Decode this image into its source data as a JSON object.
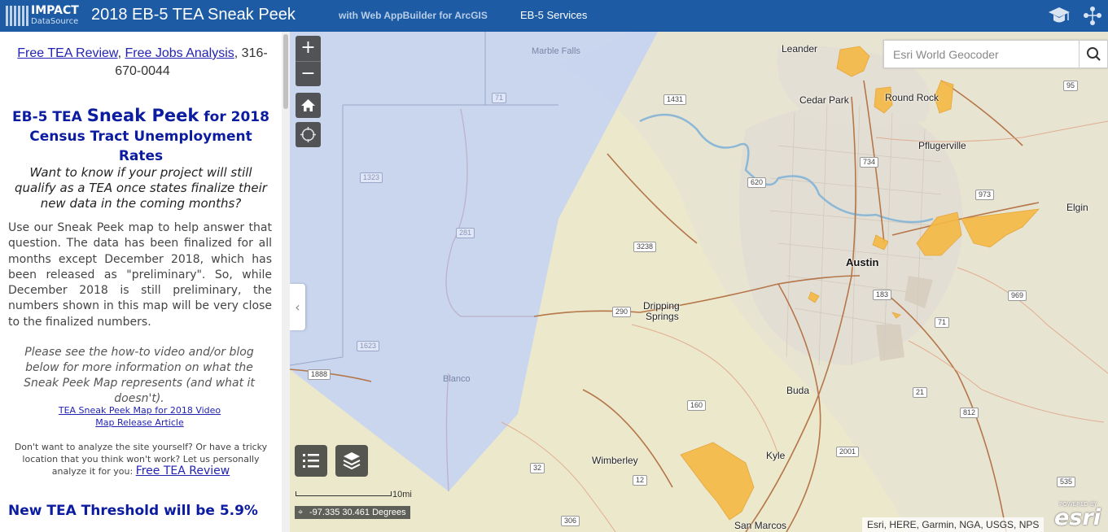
{
  "header": {
    "logo_brand": "IMPACT",
    "logo_sub": "DataSource",
    "title": "2018 EB-5 TEA Sneak Peek",
    "subtitle": "with Web AppBuilder for ArcGIS",
    "services_link": "EB-5 Services",
    "icons": [
      "graduation-cap-icon",
      "share-network-icon"
    ]
  },
  "panel": {
    "link1": "Free TEA Review",
    "sep1": ",",
    "link2": "Free Jobs Analysis",
    "phone": ", 316-670-0044",
    "title_pre": "EB-5 TEA ",
    "title_big": "Sneak Peek",
    "title_post": " for 2018 Census Tract Unemployment Rates",
    "question": "Want to know if your project will still qualify as a TEA once states finalize their new data in the coming months?",
    "body": "Use our Sneak Peek map to help answer that question. The data has been finalized for all months except December 2018, which has been released as \"preliminary\". So, while December 2018 is still preliminary, the numbers shown in this map will be very close to the finalized numbers.",
    "note": "Please see the how-to video and/or blog below for more information on what the Sneak Peek Map represents (and what it doesn't).",
    "video_link": "TEA Sneak Peek Map for 2018 Video",
    "article_link": "Map Release Article",
    "diy_text": "Don't want to analyze the site yourself? Or have a tricky location that you think won't work? Let us personally analyze it for you: ",
    "diy_link": "Free TEA Review",
    "threshold": "New TEA Threshold will be 5.9%"
  },
  "map": {
    "zoom_in": "+",
    "zoom_out": "−",
    "search_placeholder": "Esri World Geocoder",
    "scale_label": "10mi",
    "coords": "-97.335 30.461 Degrees",
    "attribution": "Esri, HERE, Garmin, NGA, USGS, NPS",
    "esri_powered": "POWERED BY",
    "esri_logo": "esri",
    "collapse_glyph": "‹",
    "places": {
      "marble_falls": "Marble Falls",
      "leander": "Leander",
      "cedar_park": "Cedar Park",
      "round_rock": "Round Rock",
      "pflugerville": "Pflugerville",
      "elgin": "Elgin",
      "austin": "Austin",
      "dripping_springs_1": "Dripping",
      "dripping_springs_2": "Springs",
      "blanco": "Blanco",
      "buda": "Buda",
      "kyle": "Kyle",
      "wimberley": "Wimberley",
      "san_marcos": "San Marcos"
    },
    "shields": {
      "s95": "95",
      "s1431": "1431",
      "s71a": "71",
      "s1323": "1323",
      "s734": "734",
      "s620": "620",
      "s973": "973",
      "s281": "281",
      "s3238": "3238",
      "s290": "290",
      "s183": "183",
      "s969": "969",
      "s71b": "71",
      "s1888": "1888",
      "s1623": "1623",
      "s21": "21",
      "s160": "160",
      "s812": "812",
      "s2001": "2001",
      "s12": "12",
      "s32": "32",
      "s306": "306",
      "s535": "535"
    }
  }
}
